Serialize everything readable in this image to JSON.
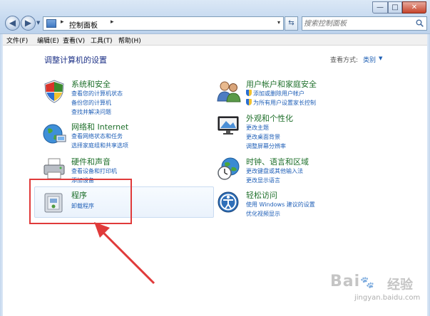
{
  "window": {
    "minimize_glyph": "—",
    "maximize_glyph": "□",
    "close_glyph": "✕"
  },
  "nav": {
    "back_glyph": "◀",
    "forward_glyph": "▶",
    "recent_glyph": "▼",
    "refresh_glyph": "⇆"
  },
  "address": {
    "separator": "▸",
    "breadcrumb": "控制面板",
    "dropdown_glyph": "▾"
  },
  "search": {
    "placeholder": "搜索控制面板"
  },
  "menubar": {
    "items": [
      "文件(F)",
      "编辑(E)",
      "查看(V)",
      "工具(T)",
      "帮助(H)"
    ]
  },
  "page": {
    "title": "调整计算机的设置",
    "view_by_label": "查看方式:",
    "view_by_value": "类别",
    "view_by_arrow": "▼"
  },
  "categories": {
    "system_security": {
      "title": "系统和安全",
      "icon": "shield-icon",
      "links": [
        "查看您的计算机状态",
        "备份您的计算机",
        "查找并解决问题"
      ]
    },
    "network": {
      "title": "网络和 Internet",
      "icon": "network-globe-icon",
      "links": [
        "查看网络状态和任务",
        "选择家庭组和共享选项"
      ]
    },
    "hardware": {
      "title": "硬件和声音",
      "icon": "printer-icon",
      "links": [
        "查看设备和打印机",
        "添加设备"
      ]
    },
    "programs": {
      "title": "程序",
      "icon": "programs-icon",
      "links": [
        "卸载程序"
      ]
    },
    "user_accounts": {
      "title": "用户帐户和家庭安全",
      "icon": "users-icon",
      "links": [
        "添加或删除用户帐户",
        "为所有用户设置家长控制"
      ]
    },
    "appearance": {
      "title": "外观和个性化",
      "icon": "display-icon",
      "links": [
        "更改主题",
        "更改桌面背景",
        "调整屏幕分辨率"
      ]
    },
    "clock_region": {
      "title": "时钟、语言和区域",
      "icon": "clock-globe-icon",
      "links": [
        "更改键盘或其他输入法",
        "更改显示语言"
      ]
    },
    "ease_access": {
      "title": "轻松访问",
      "icon": "ease-of-access-icon",
      "links": [
        "使用 Windows 建议的设置",
        "优化视频显示"
      ]
    }
  },
  "watermark": {
    "logo": "Bai",
    "paw": "🐾",
    "suffix": "经验",
    "url": "jingyan.baidu.com"
  },
  "colors": {
    "title_green": "#1e6f2a",
    "link_blue": "#1f5fb7",
    "annotation_red": "#e03a3a",
    "page_title_blue": "#1e3287"
  }
}
